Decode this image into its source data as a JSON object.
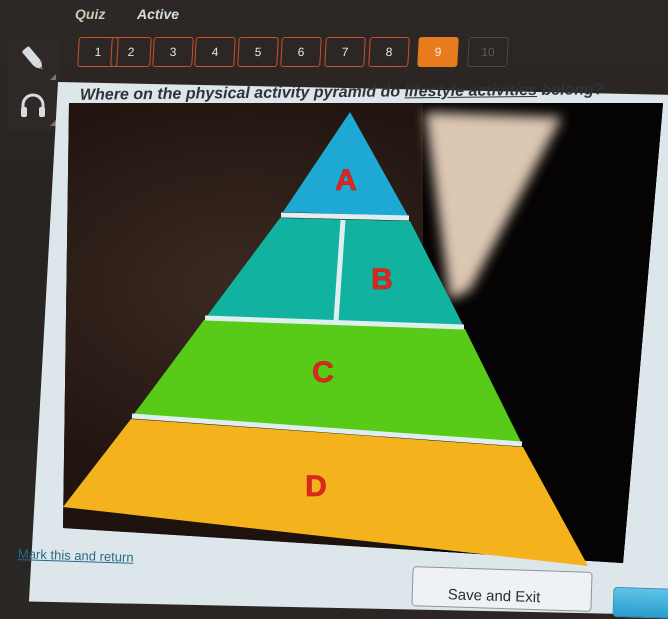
{
  "header": {
    "title": "Quiz",
    "status": "Active"
  },
  "question_nav": {
    "items": [
      {
        "label": "1",
        "state": "answered"
      },
      {
        "label": "2",
        "state": "answered"
      },
      {
        "label": "3",
        "state": "answered"
      },
      {
        "label": "4",
        "state": "answered"
      },
      {
        "label": "5",
        "state": "answered"
      },
      {
        "label": "6",
        "state": "answered"
      },
      {
        "label": "7",
        "state": "answered"
      },
      {
        "label": "8",
        "state": "answered"
      },
      {
        "label": "9",
        "state": "current"
      },
      {
        "label": "10",
        "state": "disabled"
      }
    ]
  },
  "tools": {
    "pencil": "pencil-icon",
    "audio": "headphones-icon"
  },
  "question": {
    "prefix": "Where on the physical activity pyramid do ",
    "emphasis": "lifestyle activities",
    "suffix": " belong?"
  },
  "pyramid": {
    "levels": [
      {
        "label": "A",
        "color": "#1ea9d4"
      },
      {
        "label": "B",
        "color": "#12b2a0"
      },
      {
        "label": "C",
        "color": "#58cb18"
      },
      {
        "label": "D",
        "color": "#f4b21c"
      }
    ],
    "divider_color": "#dfeff0"
  },
  "footer": {
    "mark_link": "Mark this and return",
    "save_button": "Save and Exit",
    "next_button": ""
  },
  "colors": {
    "accent": "#e87c1c",
    "nav_border": "#c8532a",
    "link": "#2a6b8a",
    "panel": "#dde6ea"
  }
}
